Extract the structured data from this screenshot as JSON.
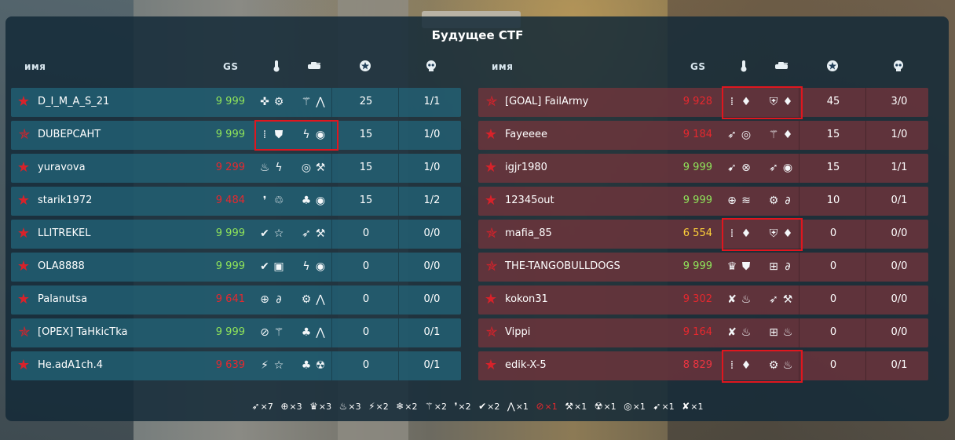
{
  "title": "Будущее CTF",
  "headers": {
    "name": "имя",
    "gs": "GS",
    "turret_icon": "thermometer-icon",
    "hull_icon": "tank-icon",
    "score_icon": "star-badge-icon",
    "deaths_icon": "skull-icon"
  },
  "team_left": [
    {
      "name": "D_I_M_A_S_21",
      "gs": "9 999",
      "gs_color": "green",
      "kd": "1/1",
      "score": "25"
    },
    {
      "name": "DUBEPCAHT",
      "gs": "9 999",
      "gs_color": "green",
      "kd": "1/0",
      "score": "15"
    },
    {
      "name": "yuravova",
      "gs": "9 299",
      "gs_color": "red",
      "kd": "1/0",
      "score": "15"
    },
    {
      "name": "starik1972",
      "gs": "9 484",
      "gs_color": "red",
      "kd": "1/2",
      "score": "15"
    },
    {
      "name": "LLITREKEL",
      "gs": "9 999",
      "gs_color": "green",
      "kd": "0/0",
      "score": "0"
    },
    {
      "name": "OLA8888",
      "gs": "9 999",
      "gs_color": "green",
      "kd": "0/0",
      "score": "0"
    },
    {
      "name": "Palanutsa",
      "gs": "9 641",
      "gs_color": "red",
      "kd": "0/0",
      "score": "0"
    },
    {
      "name": "[OPEX] TaHkicTka",
      "gs": "9 999",
      "gs_color": "green",
      "kd": "0/1",
      "score": "0"
    },
    {
      "name": "He.adA1ch.4",
      "gs": "9 639",
      "gs_color": "red",
      "kd": "0/1",
      "score": "0"
    }
  ],
  "team_right": [
    {
      "name": "[GOAL] FailArmy",
      "gs": "9 928",
      "gs_color": "red",
      "kd": "3/0",
      "score": "45"
    },
    {
      "name": "Fayeeee",
      "gs": "9 184",
      "gs_color": "red",
      "kd": "1/0",
      "score": "15"
    },
    {
      "name": "igjr1980",
      "gs": "9 999",
      "gs_color": "green",
      "kd": "1/1",
      "score": "15"
    },
    {
      "name": "12345out",
      "gs": "9 999",
      "gs_color": "green",
      "kd": "0/1",
      "score": "10"
    },
    {
      "name": "mafia_85",
      "gs": "6 554",
      "gs_color": "yellow",
      "kd": "0/0",
      "score": "0"
    },
    {
      "name": "THE-TANGOBULLDOGS",
      "gs": "9 999",
      "gs_color": "green",
      "kd": "0/0",
      "score": "0"
    },
    {
      "name": "kokon31",
      "gs": "9 302",
      "gs_color": "red",
      "kd": "0/0",
      "score": "0"
    },
    {
      "name": "Vippi",
      "gs": "9 164",
      "gs_color": "red",
      "kd": "0/0",
      "score": "0"
    },
    {
      "name": "edik-X-5",
      "gs": "8 829",
      "gs_color": "crimson",
      "kd": "0/1",
      "score": "0"
    }
  ],
  "footer_counts": [
    {
      "icon": "railgun-icon",
      "count": "×7"
    },
    {
      "icon": "crosshair-icon",
      "count": "×3"
    },
    {
      "icon": "crown-icon",
      "count": "×3"
    },
    {
      "icon": "flame-icon",
      "count": "×3"
    },
    {
      "icon": "claw-icon",
      "count": "×2"
    },
    {
      "icon": "snowflake-icon",
      "count": "×2"
    },
    {
      "icon": "feather-icon",
      "count": "×2"
    },
    {
      "icon": "drops-icon",
      "count": "×2"
    },
    {
      "icon": "check-icon",
      "count": "×2"
    },
    {
      "icon": "wing-icon",
      "count": "×1"
    },
    {
      "icon": "fire-slash-icon",
      "count": "×1",
      "red": true
    },
    {
      "icon": "hammer-icon",
      "count": "×1"
    },
    {
      "icon": "radiation-icon",
      "count": "×1"
    },
    {
      "icon": "target-icon",
      "count": "×1"
    },
    {
      "icon": "rocket-icon",
      "count": "×1"
    },
    {
      "icon": "lightning-icon",
      "count": "×1"
    }
  ],
  "colors": {
    "highlight": "#e0161e",
    "left_row": "#22667c",
    "right_row": "#78343c"
  }
}
